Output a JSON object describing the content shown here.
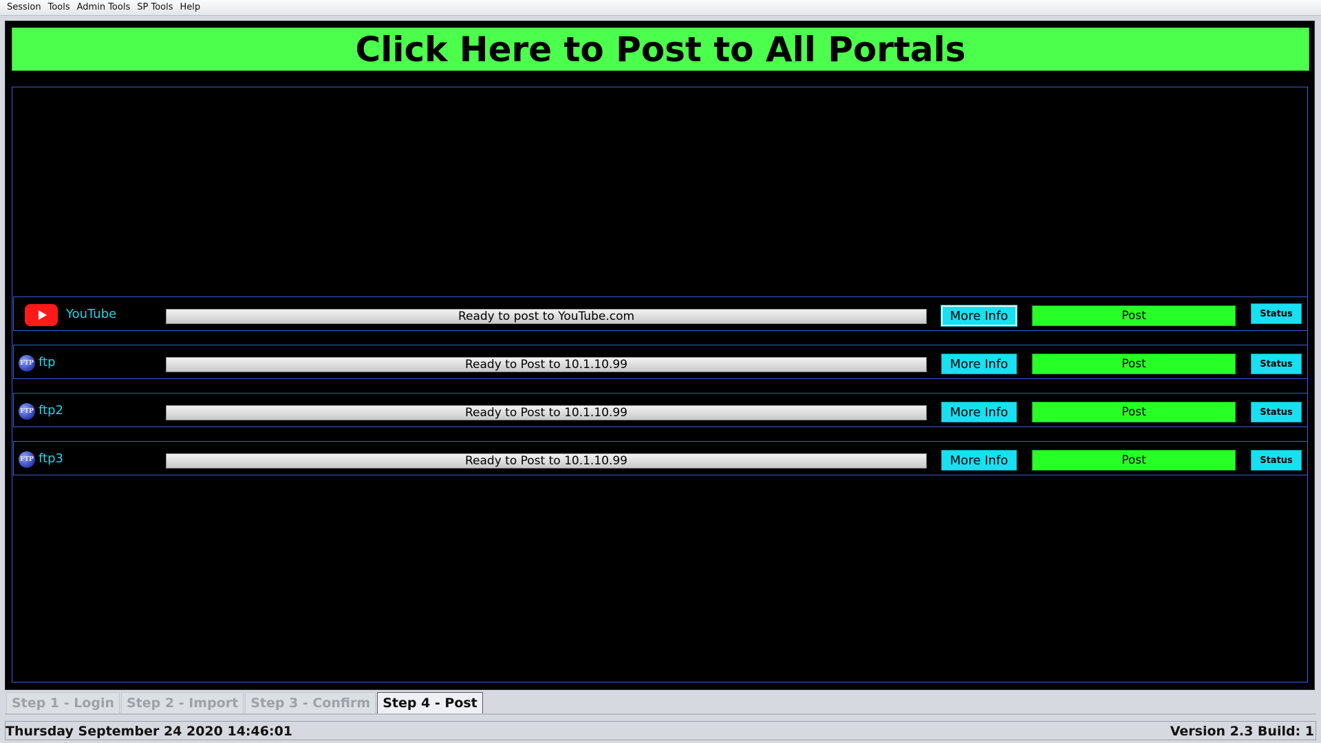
{
  "menu": {
    "items": [
      "Session",
      "Tools",
      "Admin Tools",
      "SP Tools",
      "Help"
    ]
  },
  "post_all": {
    "label": "Click Here to Post to All Portals",
    "color": "#4cff4c"
  },
  "portals": [
    {
      "name": "YouTube",
      "icon": "youtube-icon",
      "status_text": "Ready to post to YouTube.com",
      "more_info_label": "More Info",
      "post_label": "Post",
      "status_label": "Status"
    },
    {
      "name": "ftp",
      "icon": "ftp-icon",
      "icon_text": "FTP",
      "status_text": "Ready to Post to 10.1.10.99",
      "more_info_label": "More Info",
      "post_label": "Post",
      "status_label": "Status"
    },
    {
      "name": "ftp2",
      "icon": "ftp-icon",
      "icon_text": "FTP",
      "status_text": "Ready to Post to 10.1.10.99",
      "more_info_label": "More Info",
      "post_label": "Post",
      "status_label": "Status"
    },
    {
      "name": "ftp3",
      "icon": "ftp-icon",
      "icon_text": "FTP",
      "status_text": "Ready to Post to 10.1.10.99",
      "more_info_label": "More Info",
      "post_label": "Post",
      "status_label": "Status"
    }
  ],
  "tabs": [
    {
      "label": "Step 1 - Login",
      "active": false
    },
    {
      "label": "Step 2 - Import",
      "active": false
    },
    {
      "label": "Step 3 - Confirm",
      "active": false
    },
    {
      "label": "Step 4 - Post",
      "active": true
    }
  ],
  "footer": {
    "datetime": "Thursday September 24 2020 14:46:01",
    "version": "Version 2.3 Build: 1"
  },
  "colors": {
    "accent_cyan": "#18e0f0",
    "post_green": "#27ff27",
    "portal_name": "#22d4e8",
    "panel_border": "#3b5fd6"
  }
}
